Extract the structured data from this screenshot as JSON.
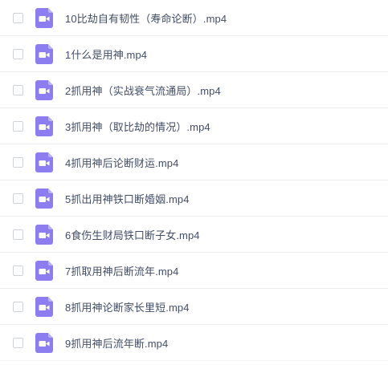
{
  "colors": {
    "icon_bg": "#8c7ef0",
    "icon_fold": "#b9b0f7",
    "icon_glyph": "#ffffff",
    "text": "#424e67",
    "divider": "#eeeeee",
    "checkbox_border": "#cfd3d9"
  },
  "files": [
    {
      "name": "10比劫自有韧性（寿命论断）.mp4",
      "icon": "video-file-icon",
      "checked": false
    },
    {
      "name": "1什么是用神.mp4",
      "icon": "video-file-icon",
      "checked": false
    },
    {
      "name": "2抓用神（实战衰气流通局）.mp4",
      "icon": "video-file-icon",
      "checked": false
    },
    {
      "name": "3抓用神（取比劫的情况）.mp4",
      "icon": "video-file-icon",
      "checked": false
    },
    {
      "name": "4抓用神后论断财运.mp4",
      "icon": "video-file-icon",
      "checked": false
    },
    {
      "name": "5抓出用神铁口断婚姻.mp4",
      "icon": "video-file-icon",
      "checked": false
    },
    {
      "name": "6食伤生财局铁口断子女.mp4",
      "icon": "video-file-icon",
      "checked": false
    },
    {
      "name": "7抓取用神后断流年.mp4",
      "icon": "video-file-icon",
      "checked": false
    },
    {
      "name": "8抓用神论断家长里短.mp4",
      "icon": "video-file-icon",
      "checked": false
    },
    {
      "name": "9抓用神后流年断.mp4",
      "icon": "video-file-icon",
      "checked": false
    }
  ]
}
